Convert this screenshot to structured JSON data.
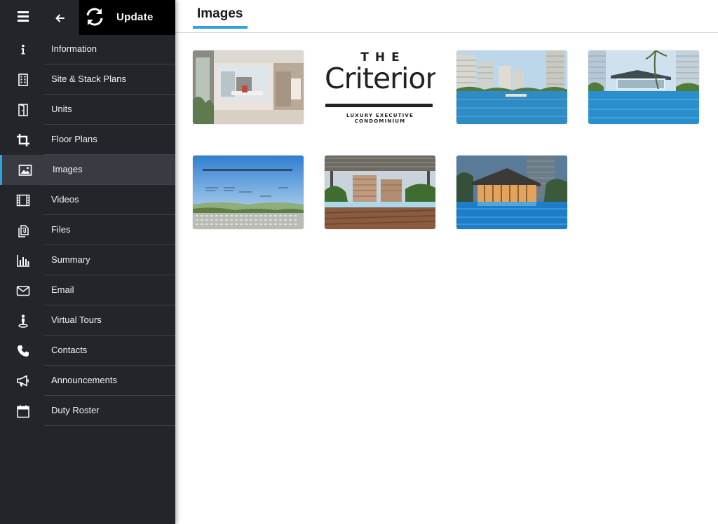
{
  "topbar": {
    "menu_icon": "hamburger-icon",
    "back_icon": "arrow-left-icon",
    "update_icon": "refresh-icon",
    "update_label": "Update"
  },
  "sidebar": {
    "active": "Images",
    "accent_color": "#2fa3dc",
    "items": [
      {
        "label": "Information",
        "icon": "info-icon"
      },
      {
        "label": "Site & Stack Plans",
        "icon": "building-icon"
      },
      {
        "label": "Units",
        "icon": "door-icon"
      },
      {
        "label": "Floor Plans",
        "icon": "crop-icon"
      },
      {
        "label": "Images",
        "icon": "image-icon"
      },
      {
        "label": "Videos",
        "icon": "film-icon"
      },
      {
        "label": "Files",
        "icon": "files-icon"
      },
      {
        "label": "Summary",
        "icon": "bar-chart-icon"
      },
      {
        "label": "Email",
        "icon": "envelope-icon"
      },
      {
        "label": "Virtual Tours",
        "icon": "person-pin-icon"
      },
      {
        "label": "Contacts",
        "icon": "phone-icon"
      },
      {
        "label": "Announcements",
        "icon": "megaphone-icon"
      },
      {
        "label": "Duty Roster",
        "icon": "calendar-icon"
      }
    ]
  },
  "main": {
    "title": "Images",
    "logo": {
      "line1": "THE",
      "line2": "Criterion",
      "line3": "LUXURY EXECUTIVE CONDOMINIUM"
    },
    "gallery": [
      {
        "name": "interior-living-photo"
      },
      {
        "name": "criterion-logo-image"
      },
      {
        "name": "pool-towers-photo"
      },
      {
        "name": "clubhouse-pool-photo"
      },
      {
        "name": "site-views-map-image"
      },
      {
        "name": "pool-deck-pergola-photo"
      },
      {
        "name": "night-clubhouse-photo"
      }
    ]
  }
}
